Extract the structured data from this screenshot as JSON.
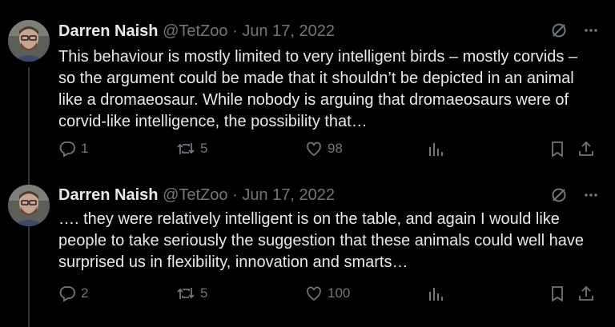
{
  "tweets": [
    {
      "author": "Darren Naish",
      "handle": "@TetZoo",
      "date": "Jun 17, 2022",
      "text": "This behaviour is mostly limited to very intelligent birds – mostly corvids – so the argument could be made that it shouldn’t be depicted in an animal like a dromaeosaur. While nobody is arguing that dromaeosaurs were of corvid-like intelligence, the possibility that…",
      "replies": "1",
      "retweets": "5",
      "likes": "98"
    },
    {
      "author": "Darren Naish",
      "handle": "@TetZoo",
      "date": "Jun 17, 2022",
      "text": "…. they were relatively intelligent is on the table, and again I would like people to take seriously the suggestion that these animals could well have surprised us in flexibility, innovation and smarts…",
      "replies": "2",
      "retweets": "5",
      "likes": "100"
    }
  ],
  "separator": "·",
  "colors": {
    "background": "#000000",
    "text": "#e7e9ea",
    "secondary": "#71767b",
    "thread_line": "#333639"
  },
  "icons": [
    "grok-icon",
    "more-icon",
    "reply-icon",
    "retweet-icon",
    "like-icon",
    "views-icon",
    "bookmark-icon",
    "share-icon"
  ]
}
